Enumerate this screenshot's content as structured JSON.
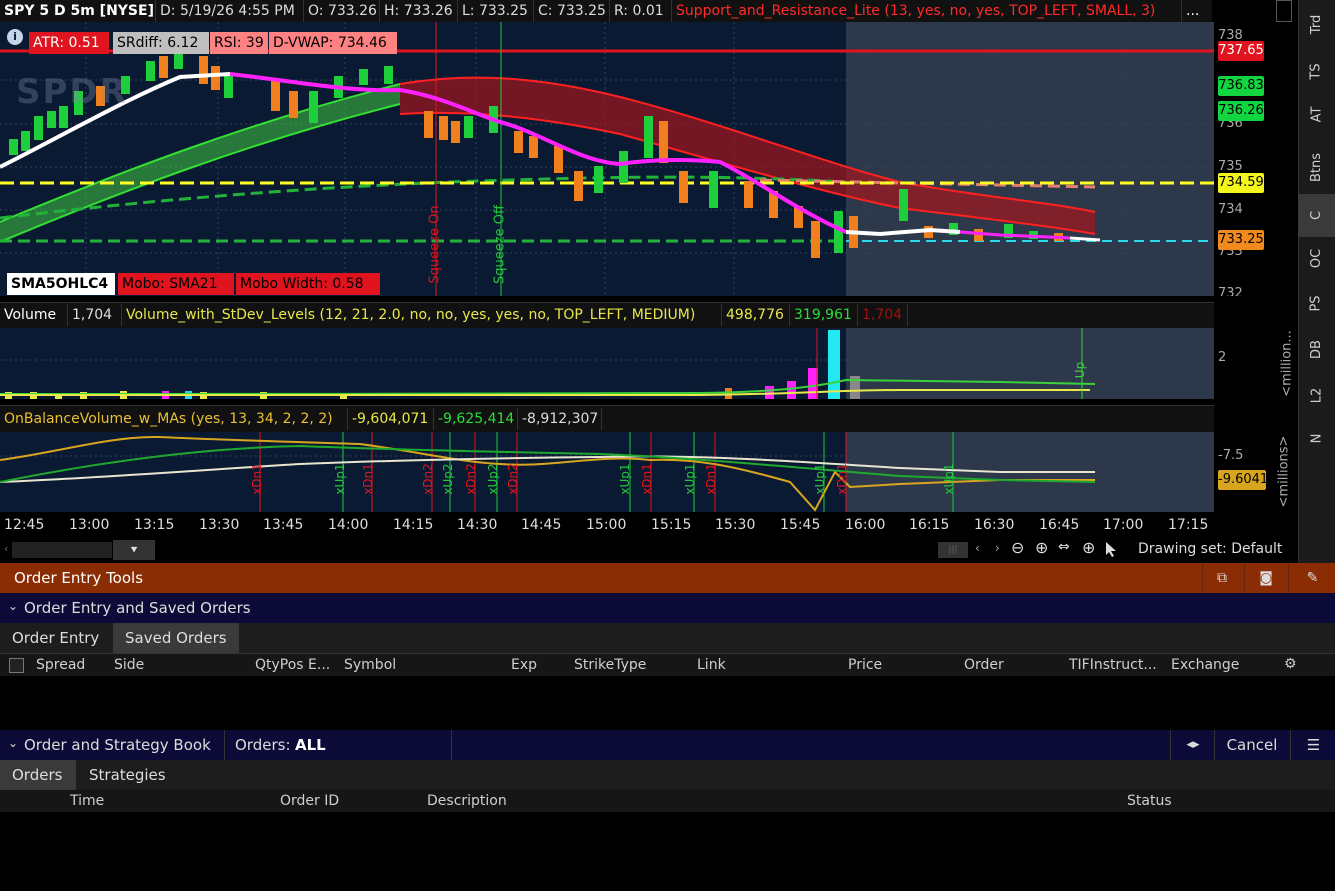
{
  "header": {
    "symbol": "SPY 5 D 5m [NYSE]",
    "date": "D: 5/19/26 4:55 PM",
    "open": "O: 733.26",
    "high": "H: 733.26",
    "low": "L: 733.25",
    "close": "C: 733.25",
    "range": "R: 0.01",
    "study": "Support_and_Resistance_Lite (13, yes, no, yes, TOP_LEFT, SMALL, 3)",
    "more": "..."
  },
  "chips_top": {
    "atr": "ATR: 0.51",
    "srdiff": "SRdiff: 6.12",
    "rsi": "RSI: 39",
    "dvwap": "D-VWAP: 734.46"
  },
  "chips_bottom": {
    "sma": "SMA5OHLC4",
    "mobo": "Mobo: SMA21",
    "width": "Mobo Width: 0.58"
  },
  "logo_text": "SPDR",
  "price_axis": {
    "ticks": [
      "738",
      "737",
      "736",
      "735",
      "734",
      "733",
      "732"
    ],
    "chips": [
      {
        "label": "737.65",
        "bg": "#e0141e",
        "fg": "#ffffff"
      },
      {
        "label": "736.83",
        "bg": "#11d640",
        "fg": "#000000"
      },
      {
        "label": "736.26",
        "bg": "#11d640",
        "fg": "#000000"
      },
      {
        "label": "734.59",
        "bg": "#f5f51e",
        "fg": "#000000"
      },
      {
        "label": "733.25",
        "bg": "#f08a1e",
        "fg": "#000000"
      }
    ]
  },
  "annotations": {
    "squeeze_on": "Squeeze On",
    "squeeze_off": "Squeeze Off"
  },
  "volume_panel": {
    "label": "Volume",
    "value": "1,704",
    "study": "Volume_with_StDev_Levels (12, 21, 2.0, no, no, yes, yes, no, TOP_LEFT, MEDIUM)",
    "v1": "498,776",
    "v2": "319,961",
    "v3": "1,704",
    "axis_tick": "2",
    "axis_unit": "<million...",
    "marker": "Up"
  },
  "obv_panel": {
    "study": "OnBalanceVolume_w_MAs (yes, 13, 34, 2, 2, 2)",
    "v1": "-9,604,071",
    "v2": "-9,625,414",
    "v3": "-8,912,307",
    "axis_tick": "-7.5",
    "axis_chip": "-9.6041",
    "axis_unit": "<millions>",
    "markers": [
      "xDn1",
      "xUp1",
      "xDn1",
      "xDn2",
      "xUp2",
      "xDn2",
      "xUp2",
      "xDn2",
      "xUp1",
      "xDn1",
      "xUp1",
      "xDn1",
      "xUp1",
      "xDn1",
      "xUp1"
    ]
  },
  "time_axis": [
    "12:45",
    "13:00",
    "13:15",
    "13:30",
    "13:45",
    "14:00",
    "14:15",
    "14:30",
    "14:45",
    "15:00",
    "15:15",
    "15:30",
    "15:45",
    "16:00",
    "16:15",
    "16:30",
    "16:45",
    "17:00",
    "17:15"
  ],
  "side_tabs": [
    "Trd",
    "TS",
    "AT",
    "Btns",
    "C",
    "OC",
    "PS",
    "DB",
    "L2",
    "N"
  ],
  "drawing_set": "Drawing set: Default",
  "order_tools": {
    "title": "Order Entry Tools",
    "section1": "Order Entry and Saved Orders",
    "tabs": [
      "Order Entry",
      "Saved Orders"
    ],
    "columns": [
      "Spread",
      "Side",
      "QtyPos E...",
      "Symbol",
      "Exp",
      "StrikeType",
      "Link",
      "Price",
      "Order",
      "TIFInstruct...",
      "Exchange"
    ],
    "section2": "Order and Strategy Book",
    "orders_label": "Orders:",
    "orders_value": "ALL",
    "cancel": "Cancel",
    "tabs2": [
      "Orders",
      "Strategies"
    ],
    "columns2": [
      "Time",
      "Order ID",
      "Description",
      "Status"
    ]
  },
  "colors": {
    "chart_bg": "#0b1a33",
    "shade_bg": "#2a3648",
    "up": "#1fce3b",
    "down": "#f07f1e",
    "accent": "#8b2d04"
  }
}
